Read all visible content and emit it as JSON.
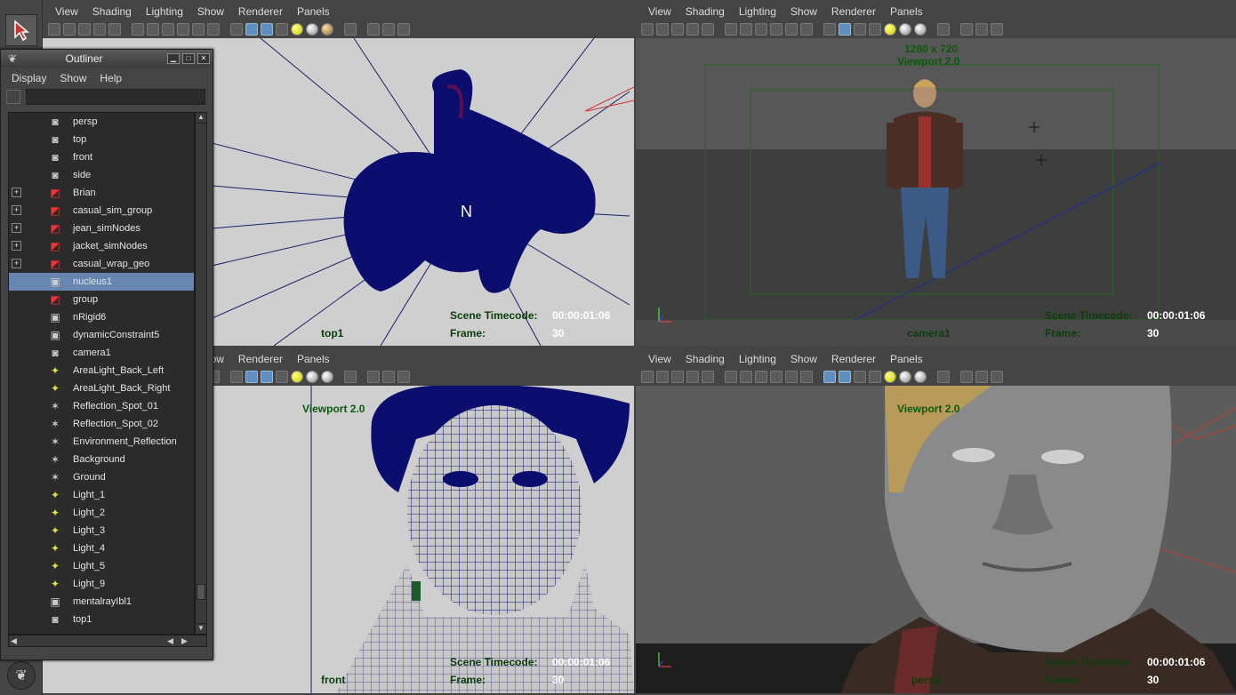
{
  "menus": {
    "view": "View",
    "shading": "Shading",
    "lighting": "Lighting",
    "show": "Show",
    "renderer": "Renderer",
    "panels": "Panels"
  },
  "outliner": {
    "title": "Outliner",
    "menu": [
      "Display",
      "Show",
      "Help"
    ],
    "items": [
      {
        "label": "persp",
        "icon": "camera-icon",
        "expand": false,
        "selected": false
      },
      {
        "label": "top",
        "icon": "camera-icon",
        "expand": false,
        "selected": false
      },
      {
        "label": "front",
        "icon": "camera-icon",
        "expand": false,
        "selected": false
      },
      {
        "label": "side",
        "icon": "camera-icon",
        "expand": false,
        "selected": false
      },
      {
        "label": "Brian",
        "icon": "group-icon",
        "expand": true,
        "selected": false
      },
      {
        "label": "casual_sim_group",
        "icon": "group-icon",
        "expand": true,
        "selected": false
      },
      {
        "label": "jean_simNodes",
        "icon": "group-icon",
        "expand": true,
        "selected": false
      },
      {
        "label": "jacket_simNodes",
        "icon": "group-icon",
        "expand": true,
        "selected": false
      },
      {
        "label": "casual_wrap_geo",
        "icon": "group-icon",
        "expand": true,
        "selected": false
      },
      {
        "label": "nucleus1",
        "icon": "nucleus-icon",
        "expand": false,
        "selected": true
      },
      {
        "label": "group",
        "icon": "group-icon",
        "expand": false,
        "selected": false
      },
      {
        "label": "nRigid6",
        "icon": "nucleus-icon",
        "expand": false,
        "selected": false
      },
      {
        "label": "dynamicConstraint5",
        "icon": "nucleus-icon",
        "expand": false,
        "selected": false
      },
      {
        "label": "camera1",
        "icon": "camera-icon",
        "expand": false,
        "selected": false
      },
      {
        "label": "AreaLight_Back_Left",
        "icon": "light-icon",
        "expand": false,
        "selected": false
      },
      {
        "label": "AreaLight_Back_Right",
        "icon": "light-icon",
        "expand": false,
        "selected": false
      },
      {
        "label": "Reflection_Spot_01",
        "icon": "spot-icon",
        "expand": false,
        "selected": false
      },
      {
        "label": "Reflection_Spot_02",
        "icon": "spot-icon",
        "expand": false,
        "selected": false
      },
      {
        "label": "Environment_Reflection",
        "icon": "spot-icon",
        "expand": false,
        "selected": false
      },
      {
        "label": "Background",
        "icon": "spot-icon",
        "expand": false,
        "selected": false
      },
      {
        "label": "Ground",
        "icon": "spot-icon",
        "expand": false,
        "selected": false
      },
      {
        "label": "Light_1",
        "icon": "light-icon",
        "expand": false,
        "selected": false
      },
      {
        "label": "Light_2",
        "icon": "light-icon",
        "expand": false,
        "selected": false
      },
      {
        "label": "Light_3",
        "icon": "light-icon",
        "expand": false,
        "selected": false
      },
      {
        "label": "Light_4",
        "icon": "light-icon",
        "expand": false,
        "selected": false
      },
      {
        "label": "Light_5",
        "icon": "light-icon",
        "expand": false,
        "selected": false
      },
      {
        "label": "Light_9",
        "icon": "light-icon",
        "expand": false,
        "selected": false
      },
      {
        "label": "mentalrayIbl1",
        "icon": "nucleus-icon",
        "expand": false,
        "selected": false
      },
      {
        "label": "top1",
        "icon": "camera-icon",
        "expand": false,
        "selected": false
      }
    ]
  },
  "viewports": {
    "top_left": {
      "camera": "top1",
      "timecode_label": "Scene Timecode:",
      "timecode": "00:00:01:06",
      "frame_label": "Frame:",
      "frame": "30",
      "axis_letter": "N"
    },
    "top_right": {
      "resolution": "1280 x 720",
      "renderer": "Viewport 2.0",
      "camera": "camera1",
      "timecode_label": "Scene Timecode:",
      "timecode": "00:00:01:06",
      "frame_label": "Frame:",
      "frame": "30"
    },
    "bottom_left": {
      "renderer": "Viewport 2.0",
      "camera": "front",
      "timecode_label": "Scene Timecode:",
      "timecode": "00:00:01:06",
      "frame_label": "Frame:",
      "frame": "30"
    },
    "bottom_right": {
      "renderer": "Viewport 2.0",
      "camera": "persp",
      "timecode_label": "Scene Timecode:",
      "timecode": "00:00:01:06",
      "frame_label": "Frame:",
      "frame": "30"
    }
  },
  "colors": {
    "wireframe": "#0b0e6e",
    "hud_green": "#0b5a0b",
    "selection": "#6787b0"
  }
}
